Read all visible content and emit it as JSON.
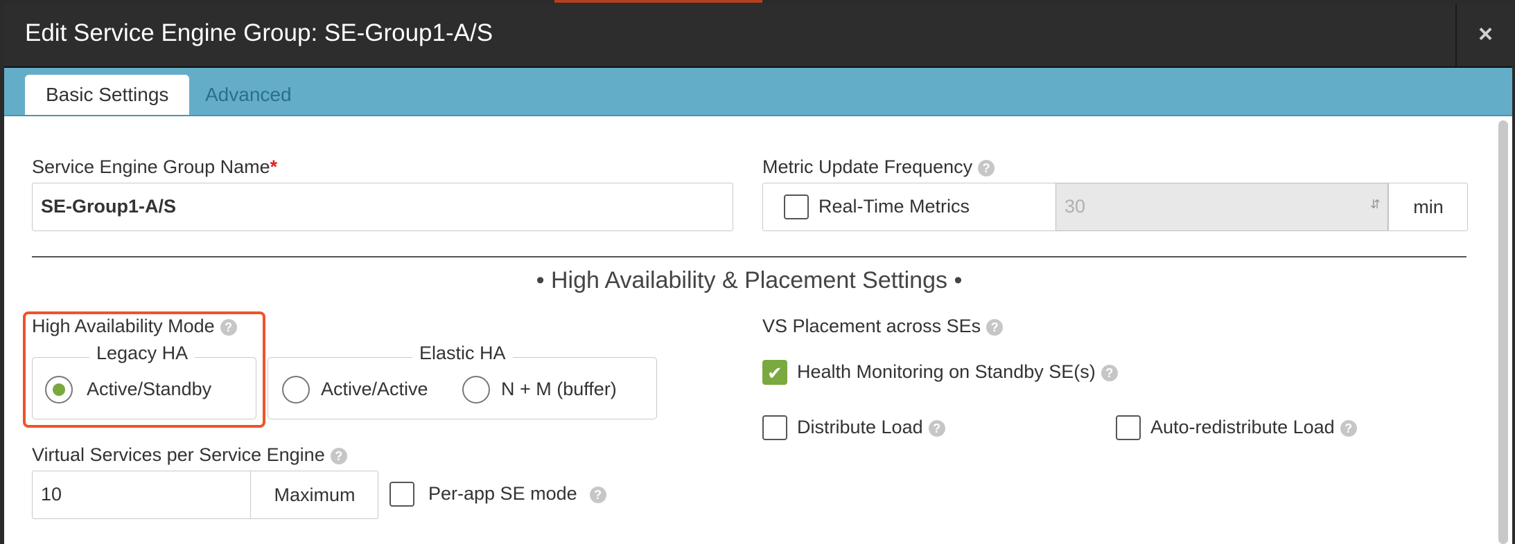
{
  "window": {
    "title": "Edit Service Engine Group: SE-Group1-A/S",
    "close_glyph": "×"
  },
  "tabs": [
    {
      "label": "Basic Settings",
      "active": true
    },
    {
      "label": "Advanced",
      "active": false
    }
  ],
  "form": {
    "se_group_name": {
      "label": "Service Engine Group Name",
      "required_mark": "*",
      "value": "SE-Group1-A/S"
    },
    "metric_update": {
      "label": "Metric Update Frequency",
      "realtime_label": "Real-Time Metrics",
      "realtime_checked": false,
      "value": "30",
      "unit": "min"
    },
    "section_title": "• High Availability & Placement Settings •",
    "ha_mode": {
      "label": "High Availability Mode",
      "legacy_group": "Legacy HA",
      "elastic_group": "Elastic HA",
      "options": [
        {
          "label": "Active/Standby",
          "selected": true
        },
        {
          "label": "Active/Active",
          "selected": false
        },
        {
          "label": "N + M (buffer)",
          "selected": false
        }
      ]
    },
    "vs_per_se": {
      "label": "Virtual Services per Service Engine",
      "value": "10",
      "suffix": "Maximum",
      "per_app_label": "Per-app SE mode",
      "per_app_checked": false
    },
    "vs_placement": {
      "label": "VS Placement across SEs",
      "health_monitoring_label": "Health Monitoring on Standby SE(s)",
      "health_monitoring_checked": true,
      "distribute_label": "Distribute Load",
      "distribute_checked": false,
      "auto_redistribute_label": "Auto-redistribute Load",
      "auto_redistribute_checked": false
    }
  },
  "icons": {
    "help": "question-circle-icon",
    "help_glyph": "?",
    "spinner": "updown-spinner-icon",
    "check": "checkmark-icon"
  },
  "colors": {
    "header_bg": "#2d2d2d",
    "tabbar_bg": "#63adc9",
    "accent_green": "#79a93f",
    "highlight_orange": "#f0532a",
    "required_red": "#e0201d"
  }
}
